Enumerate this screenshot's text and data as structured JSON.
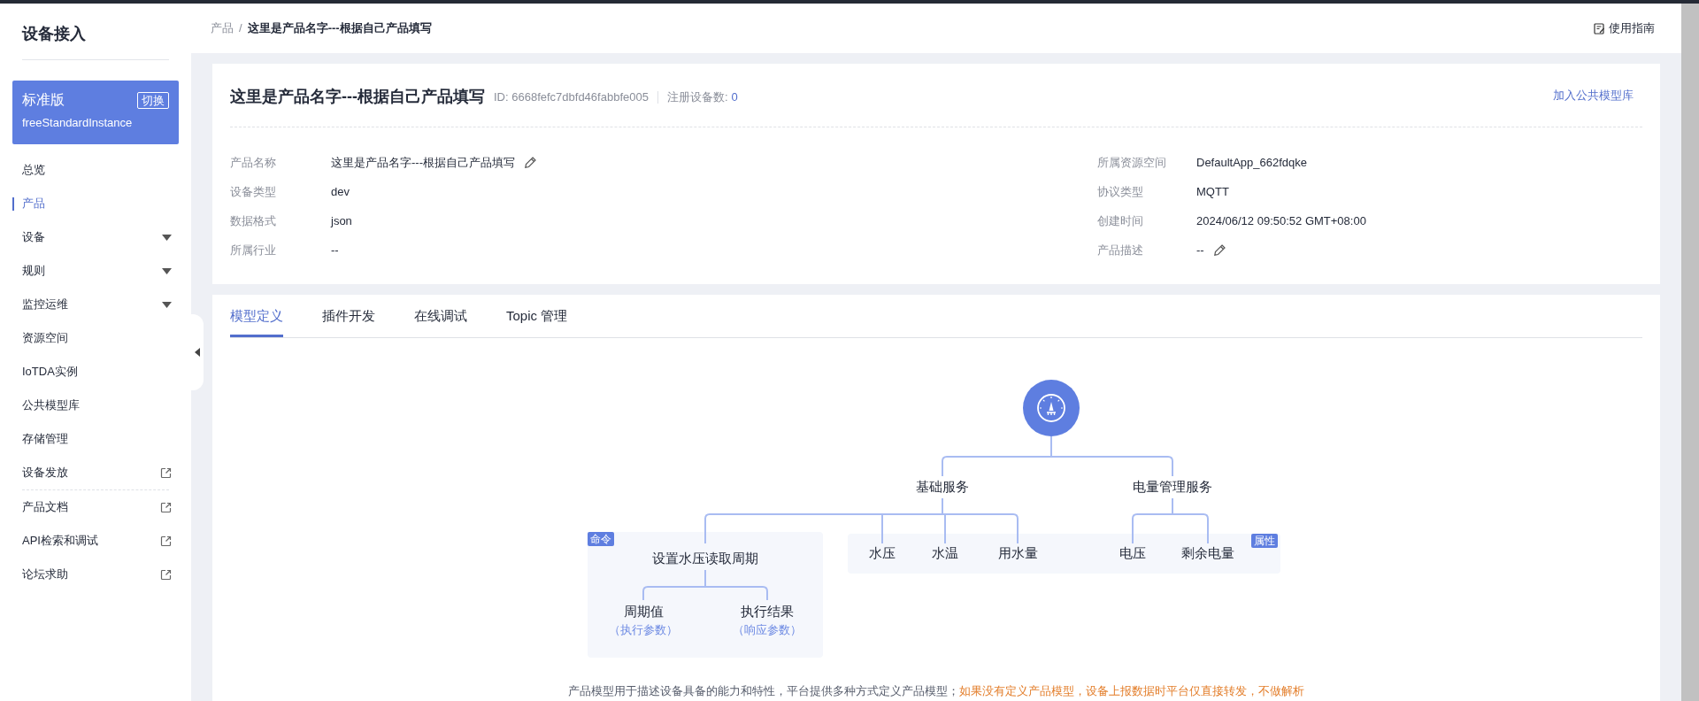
{
  "sidebar": {
    "title": "设备接入",
    "instance": {
      "edition": "标准版",
      "switch_button": "切换",
      "name": "freeStandardInstance"
    },
    "items": [
      {
        "label": "总览",
        "kind": "plain",
        "selected": false
      },
      {
        "label": "产品",
        "kind": "plain",
        "selected": true
      },
      {
        "label": "设备",
        "kind": "dropdown",
        "selected": false
      },
      {
        "label": "规则",
        "kind": "dropdown",
        "selected": false
      },
      {
        "label": "监控运维",
        "kind": "dropdown",
        "selected": false
      },
      {
        "label": "资源空间",
        "kind": "plain",
        "selected": false
      },
      {
        "label": "IoTDA实例",
        "kind": "plain",
        "selected": false
      },
      {
        "label": "公共模型库",
        "kind": "plain",
        "selected": false
      },
      {
        "label": "存储管理",
        "kind": "plain",
        "selected": false
      },
      {
        "label": "设备发放",
        "kind": "external",
        "selected": false
      }
    ],
    "doc_links": [
      {
        "label": "产品文档"
      },
      {
        "label": "API检索和调试"
      },
      {
        "label": "论坛求助"
      }
    ]
  },
  "breadcrumb": [
    "产品",
    "这里是产品名字---根据自己产品填写"
  ],
  "breadcrumb_separator": "/",
  "guide_link": "使用指南",
  "product": {
    "title": "这里是产品名字---根据自己产品填写",
    "id": "ID: 6668fefc7dbfd46fabbfe005",
    "device_count_label": "注册设备数:",
    "device_count": "0",
    "add_button": "加入公共模型库",
    "left_fields": [
      {
        "label": "产品名称",
        "value": "这里是产品名字---根据自己产品填写",
        "editable": true
      },
      {
        "label": "设备类型",
        "value": "dev",
        "editable": false
      },
      {
        "label": "数据格式",
        "value": "json",
        "editable": false
      },
      {
        "label": "所属行业",
        "value": "--",
        "editable": false
      }
    ],
    "right_fields": [
      {
        "label": "所属资源空间",
        "value": "DefaultApp_662fdqke",
        "editable": false
      },
      {
        "label": "协议类型",
        "value": "MQTT",
        "editable": false
      },
      {
        "label": "创建时间",
        "value": "2024/06/12 09:50:52 GMT+08:00",
        "editable": false
      },
      {
        "label": "产品描述",
        "value": "--",
        "editable": true
      }
    ]
  },
  "tabs": [
    {
      "label": "模型定义",
      "selected": true
    },
    {
      "label": "插件开发",
      "selected": false
    },
    {
      "label": "在线调试",
      "selected": false
    },
    {
      "label": "Topic 管理",
      "selected": false
    }
  ],
  "model": {
    "command_tag": "命令",
    "property_tag": "属性",
    "services": [
      {
        "name": "基础服务",
        "properties": [
          "水压",
          "水温",
          "用水量"
        ],
        "commands": [
          {
            "name": "设置水压读取周期",
            "params": [
              {
                "name": "周期值",
                "role": "（执行参数）"
              },
              {
                "name": "执行结果",
                "role": "（响应参数）"
              }
            ]
          }
        ]
      },
      {
        "name": "电量管理服务",
        "properties": [
          "电压",
          "剩余电量"
        ]
      }
    ]
  },
  "note": {
    "text": "产品模型用于描述设备具备的能力和特性，平台提供多种方式定义产品模型；",
    "warning": "如果没有定义产品模型，设备上报数据时平台仅直接转发，不做解析"
  }
}
